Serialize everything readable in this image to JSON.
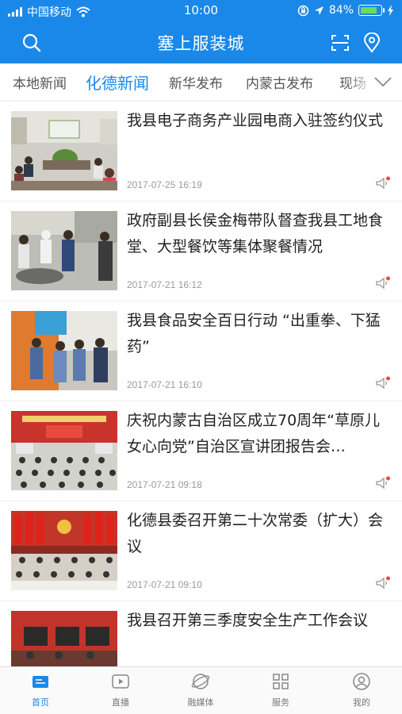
{
  "status_bar": {
    "carrier": "中国移动",
    "time": "10:00",
    "battery": "84%",
    "battery_level": 0.84
  },
  "header": {
    "title": "塞上服装城"
  },
  "tabs": [
    {
      "label": "本地新闻",
      "active": false
    },
    {
      "label": "化德新闻",
      "active": true
    },
    {
      "label": "新华发布",
      "active": false
    },
    {
      "label": "内蒙古发布",
      "active": false
    },
    {
      "label": "现场",
      "active": false
    }
  ],
  "news": [
    {
      "title": "我县电子商务产业园电商入驻签约仪式",
      "date": "2017-07-25 16:19"
    },
    {
      "title": "政府副县长侯金梅带队督查我县工地食堂、大型餐饮等集体聚餐情况",
      "date": "2017-07-21 16:12"
    },
    {
      "title": "我县食品安全百日行动 “出重拳、下猛药”",
      "date": "2017-07-21 16:10"
    },
    {
      "title": "庆祝内蒙古自治区成立70周年“草原儿女心向党”自治区宣讲团报告会…",
      "date": "2017-07-21 09:18"
    },
    {
      "title": "化德县委召开第二十次常委（扩大）会议",
      "date": "2017-07-21 09:10"
    },
    {
      "title": "我县召开第三季度安全生产工作会议",
      "date": ""
    }
  ],
  "bottom_nav": [
    {
      "label": "首页",
      "icon": "home-news-icon",
      "active": true
    },
    {
      "label": "直播",
      "icon": "play-icon",
      "active": false
    },
    {
      "label": "融媒体",
      "icon": "globe-icon",
      "active": false
    },
    {
      "label": "服务",
      "icon": "grid-icon",
      "active": false
    },
    {
      "label": "我的",
      "icon": "user-icon",
      "active": false
    }
  ],
  "colors": {
    "accent": "#1a88e8",
    "battery": "#6cdb5a",
    "notification_dot": "#e84a3c"
  }
}
